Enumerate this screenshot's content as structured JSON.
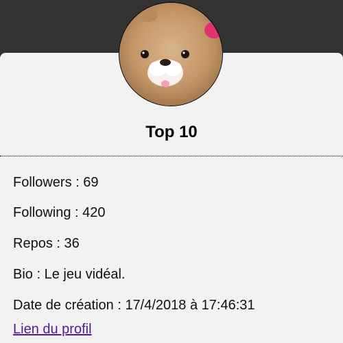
{
  "profile": {
    "name": "Top 10",
    "avatar_icon": "plush-beaver-avatar",
    "stats": {
      "followers_label": "Followers",
      "followers": "69",
      "following_label": "Following",
      "following": "420",
      "repos_label": "Repos",
      "repos": "36",
      "bio_label": "Bio",
      "bio": "Le jeu vidéal.",
      "created_label": "Date de création",
      "created": "17/4/2018 à 17:46:31"
    },
    "link_label": "Lien du profil"
  },
  "colors": {
    "background": "#333333",
    "card": "#f2f2f2",
    "link": "#551a8b"
  }
}
